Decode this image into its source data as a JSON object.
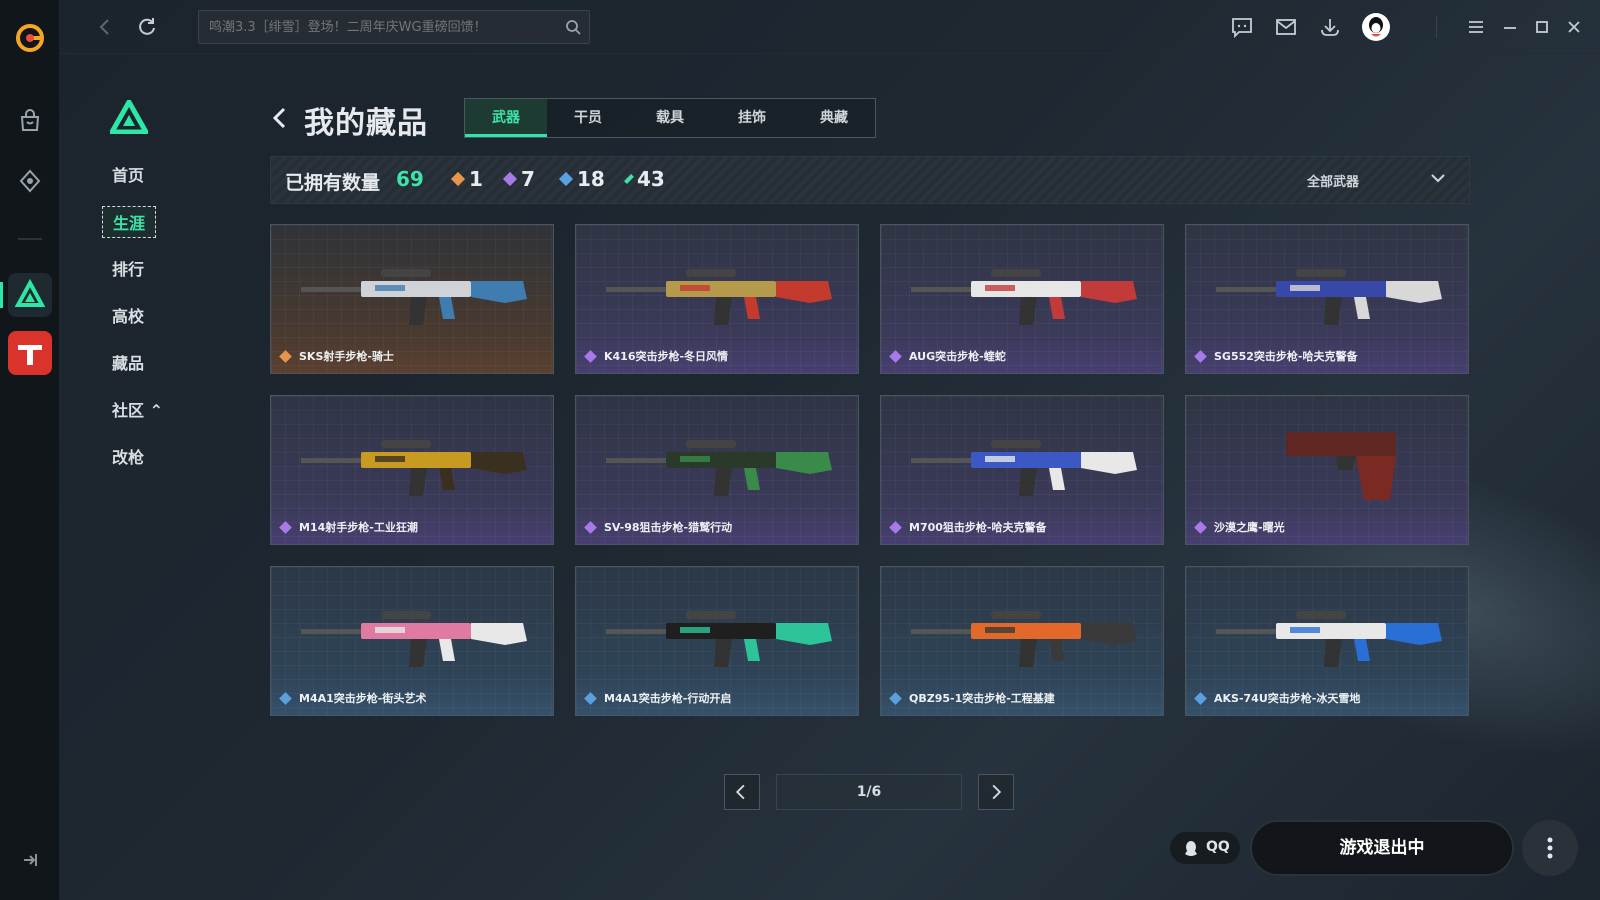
{
  "search": {
    "placeholder": "鸣潮3.3［绯雪］登场！二周年庆WG重磅回馈！"
  },
  "sidebar": {
    "items": [
      {
        "label": "首页"
      },
      {
        "label": "生涯"
      },
      {
        "label": "排行"
      },
      {
        "label": "高校"
      },
      {
        "label": "藏品"
      },
      {
        "label": "社区 ⌃"
      },
      {
        "label": "改枪"
      }
    ]
  },
  "page": {
    "title": "我的藏品",
    "tabs": [
      "武器",
      "干员",
      "载具",
      "挂饰",
      "典藏"
    ]
  },
  "stats": {
    "owned_label": "已拥有数量",
    "owned_total": "69",
    "rarity_counts": [
      {
        "count": "1",
        "color": "#e8944a"
      },
      {
        "count": "7",
        "color": "#a779e9"
      },
      {
        "count": "18",
        "color": "#5aa0e0"
      },
      {
        "count": "43",
        "color": "#3de3a8"
      }
    ],
    "filter_label": "全部武器"
  },
  "collection": [
    {
      "name": "SKS射手步枪-骑士",
      "rarity": "gold"
    },
    {
      "name": "K416突击步枪-冬日风情",
      "rarity": "purple"
    },
    {
      "name": "AUG突击步枪-蝰蛇",
      "rarity": "purple"
    },
    {
      "name": "SG552突击步枪-哈夫克警备",
      "rarity": "purple"
    },
    {
      "name": "M14射手步枪-工业狂潮",
      "rarity": "purple"
    },
    {
      "name": "SV-98狙击步枪-猎鹫行动",
      "rarity": "purple"
    },
    {
      "name": "M700狙击步枪-哈夫克警备",
      "rarity": "purple"
    },
    {
      "name": "沙漠之鹰-曙光",
      "rarity": "purple"
    },
    {
      "name": "M4A1突击步枪-街头艺术",
      "rarity": "blue"
    },
    {
      "name": "M4A1突击步枪-行动开启",
      "rarity": "blue"
    },
    {
      "name": "QBZ95-1突击步枪-工程基建",
      "rarity": "blue"
    },
    {
      "name": "AKS-74U突击步枪-冰天雪地",
      "rarity": "blue"
    }
  ],
  "pagination": {
    "label": "1/6"
  },
  "footer": {
    "qq_label": "QQ",
    "play_label": "游戏退出中"
  },
  "colors": {
    "accent": "#2ee6a6",
    "gold": "#e8944a",
    "purple": "#a779e9",
    "blue": "#5aa0e0"
  }
}
